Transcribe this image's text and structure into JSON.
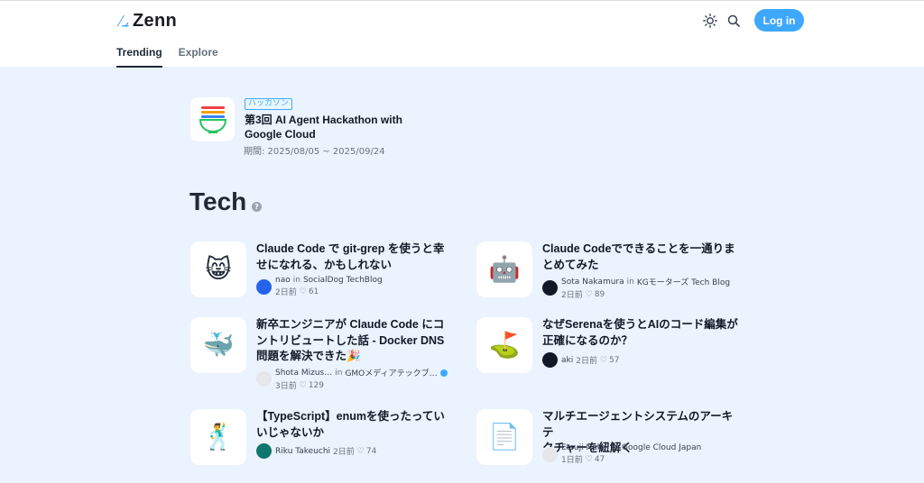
{
  "header": {
    "logo_text": "Zenn",
    "login_label": "Log in",
    "tabs": [
      "Trending",
      "Explore"
    ]
  },
  "event": {
    "tag": "ハッカソン",
    "title_line1": "第3回 AI Agent Hackathon with",
    "title_line2": "Google Cloud",
    "period": "期間: 2025/08/05 ~ 2025/09/24"
  },
  "section": {
    "title": "Tech",
    "help": "?"
  },
  "articles": [
    {
      "title_line1": "Claude Code で git-grep を使うと幸",
      "title_line2": "せになれる、かもしれない",
      "title_line3": "",
      "author": "nao",
      "in": "in",
      "publication": "SocialDog TechBlog",
      "date": "2日前",
      "likes": "61",
      "emoji": "😸"
    },
    {
      "title_line1": "Claude Codeでできることを一通りま",
      "title_line2": "とめてみた",
      "title_line3": "",
      "author": "Sota Nakamura",
      "in": "in",
      "publication": "KGモーターズ Tech Blog",
      "date": "2日前",
      "likes": "89",
      "emoji": "🤖"
    },
    {
      "title_line1": "新卒エンジニアが Claude Code にコ",
      "title_line2": "ントリビュートした話 - Docker DNS",
      "title_line3": "問題を解決できた🎉",
      "author": "Shota Mizus…",
      "in": "in",
      "publication": "GMOメディアテックブ…",
      "date": "3日前",
      "likes": "129",
      "emoji": "🐳"
    },
    {
      "title_line1": "なぜSerenaを使うとAIのコード編集が",
      "title_line2": "正確になるのか？",
      "title_line3": "",
      "author": "aki",
      "in": "",
      "publication": "",
      "date": "2日前",
      "likes": "57",
      "emoji": "⛳"
    },
    {
      "title_line1": "【TypeScript】enumを使ったってい",
      "title_line2": "いじゃないか",
      "title_line3": "",
      "author": "Riku Takeuchi",
      "in": "",
      "publication": "",
      "date": "2日前",
      "likes": "74",
      "emoji": "🕺"
    },
    {
      "title_line1": "マルチエージェントシステムのアーキテ",
      "title_line2": "クチャーを紐解く",
      "title_line3": "",
      "author": "Etsuji Nakai",
      "in": "in",
      "publication": "Google Cloud Japan",
      "date": "1日前",
      "likes": "47",
      "emoji": "📄"
    }
  ]
}
